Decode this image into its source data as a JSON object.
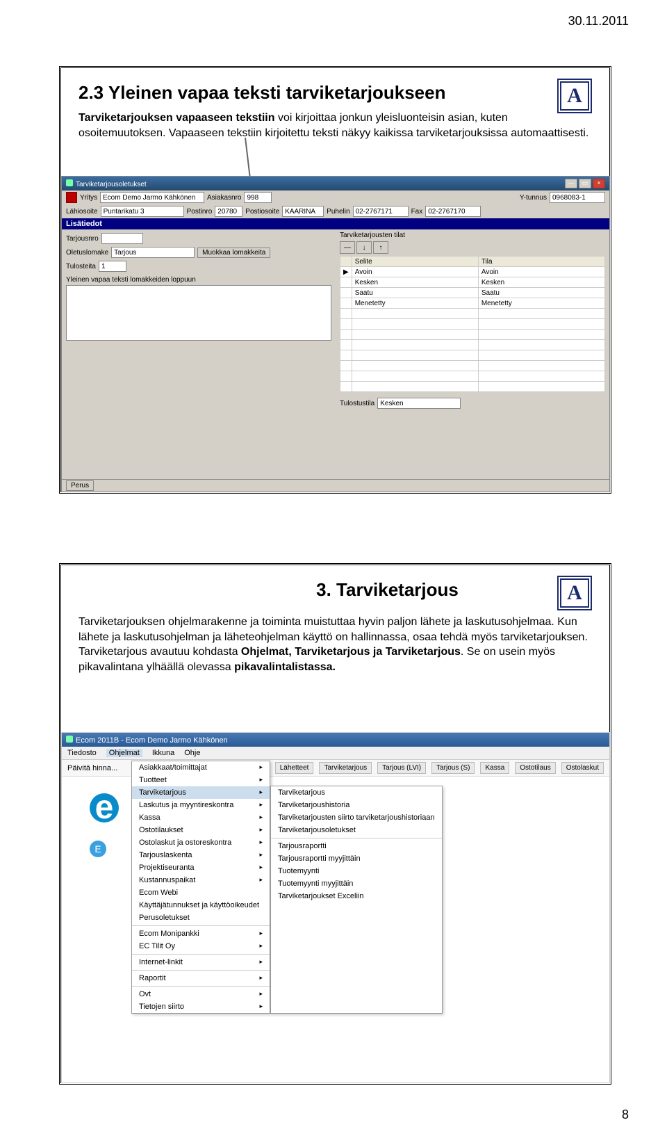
{
  "page": {
    "date": "30.11.2011",
    "number": "8"
  },
  "slide1": {
    "title": "2.3 Yleinen vapaa teksti tarviketarjoukseen",
    "body_parts": [
      "Tarviketarjouksen vapaaseen tekstiin",
      " voi kirjoittaa jonkun yleisluonteisin asian, kuten osoitemuutoksen. Vapaaseen tekstiin kirjoitettu teksti näkyy kaikissa tarviketarjouksissa automaattisesti."
    ],
    "window_title": "Tarviketarjousoletukset",
    "row1": {
      "yritys_l": "Yritys",
      "yritys_v": "Ecom Demo Jarmo Kähkönen",
      "asiakas_l": "Asiakasnro",
      "asiakas_v": "998",
      "ytunnus_l": "Y-tunnus",
      "ytunnus_v": "0968083-1"
    },
    "row2": {
      "lahi_l": "Lähiosoite",
      "lahi_v": "Puntarikatu 3",
      "postinro_l": "Postinro",
      "postinro_v": "20780",
      "posti_l": "Postiosoite",
      "posti_v": "KAARINA",
      "puh_l": "Puhelin",
      "puh_v": "02-2767171",
      "fax_l": "Fax",
      "fax_v": "02-2767170"
    },
    "lisatiedot": "Lisätiedot",
    "left": {
      "tarjousnro": "Tarjousnro",
      "oletus_l": "Oletuslomake",
      "oletus_v": "Tarjous",
      "muokkaa": "Muokkaa lomakkeita",
      "tulosteita_l": "Tulosteita",
      "tulosteita_v": "1",
      "yleinen": "Yleinen vapaa teksti lomakkeiden loppuun"
    },
    "right": {
      "heading": "Tarviketarjousten tilat",
      "cols": {
        "selite": "Selite",
        "tila": "Tila"
      },
      "rows": [
        {
          "s": "Avoin",
          "t": "Avoin"
        },
        {
          "s": "Kesken",
          "t": "Kesken"
        },
        {
          "s": "Saatu",
          "t": "Saatu"
        },
        {
          "s": "Menetetty",
          "t": "Menetetty"
        }
      ],
      "tulostustila_l": "Tulostustila",
      "tulostustila_v": "Kesken"
    },
    "status": "Perus",
    "logo_letter": "A"
  },
  "slide2": {
    "title": "3. Tarviketarjous",
    "body_pre": "Tarviketarjouksen ohjelmarakenne ja toiminta muistuttaa hyvin paljon lähete ja laskutusohjelmaa. Kun lähete ja laskutusohjelman ja läheteohjelman käyttö on hallinnassa, osaa tehdä myös tarviketarjouksen. Tarviketarjous avautuu kohdasta ",
    "body_bold1": "Ohjelmat, Tarviketarjous ja Tarviketarjous",
    "body_mid": ". Se on usein myös pikavalintana ylhäällä olevassa ",
    "body_bold2": "pikavalintalistassa.",
    "window_title": "Ecom 2011B - Ecom Demo Jarmo Kähkönen",
    "menus": [
      "Tiedosto",
      "Ohjelmat",
      "Ikkuna",
      "Ohje"
    ],
    "toolbar": {
      "paivita": "Päivitä hinna...",
      "tabs": [
        "Lähetteet",
        "Tarviketarjous",
        "Tarjous (LVI)",
        "Tarjous (S)",
        "Kassa",
        "Ostotilaus",
        "Ostolaskut"
      ]
    },
    "ecom_logo": "ecom",
    "left_menu": [
      "Asiakkaat/toimittajat",
      "Tuotteet",
      "Tarviketarjous",
      "Laskutus ja myyntireskontra",
      "Kassa",
      "Ostotilaukset",
      "Ostolaskut ja ostoreskontra",
      "Tarjouslaskenta",
      "Projektiseuranta",
      "Kustannuspaikat",
      "Ecom Webi",
      "Käyttäjätunnukset ja käyttöoikeudet",
      "Perusoletukset"
    ],
    "left_menu2": [
      "Ecom Monipankki",
      "EC Tilit Oy"
    ],
    "left_menu3": [
      "Internet-linkit"
    ],
    "left_menu4": [
      "Raportit"
    ],
    "left_menu5": [
      "Ovt",
      "Tietojen siirto"
    ],
    "sub_menu_a": [
      "Tarviketarjous",
      "Tarviketarjoushistoria",
      "Tarviketarjousten siirto tarviketarjoushistoriaan",
      "Tarviketarjousoletukset"
    ],
    "sub_menu_b": [
      "Tarjousraportti",
      "Tarjousraportti myyjittäin",
      "Tuotemyynti",
      "Tuotemyynti myyjittäin",
      "Tarviketarjoukset Exceliin"
    ],
    "browser_tab": "E"
  }
}
